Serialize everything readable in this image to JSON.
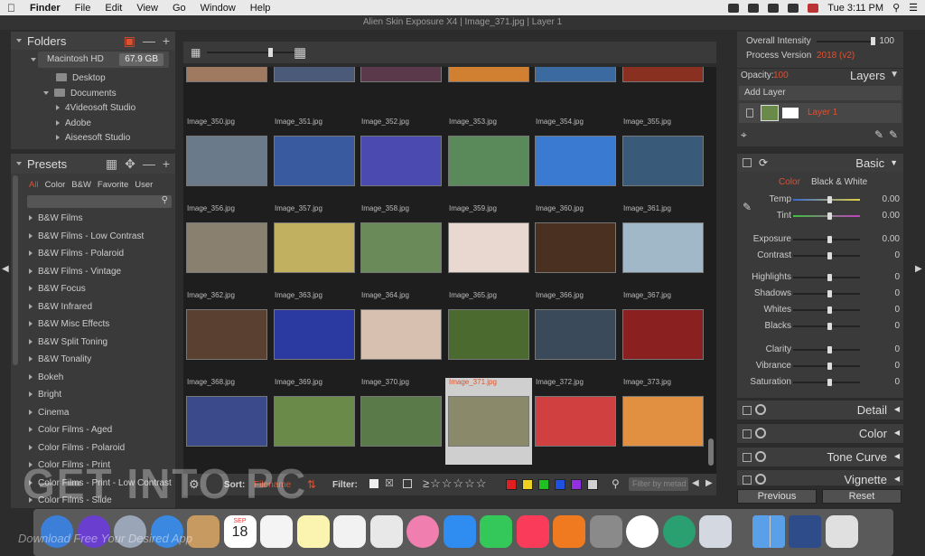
{
  "menubar": {
    "apple": "",
    "app": "Finder",
    "items": [
      "File",
      "Edit",
      "View",
      "Go",
      "Window",
      "Help"
    ],
    "clock": "Tue 3:11 PM"
  },
  "window_title": "Alien Skin Exposure X4 | Image_371.jpg | Layer 1",
  "folders": {
    "title": "Folders",
    "drive": "Macintosh HD",
    "drive_size": "67.9 GB",
    "items": [
      "Desktop",
      "Documents",
      "4Videosoft Studio",
      "Adobe",
      "Aiseesoft Studio"
    ]
  },
  "presets": {
    "title": "Presets",
    "tabs": [
      "All",
      "Color",
      "B&W",
      "Favorite",
      "User"
    ],
    "items": [
      "B&W Films",
      "B&W Films - Low Contrast",
      "B&W Films - Polaroid",
      "B&W Films - Vintage",
      "B&W Focus",
      "B&W Infrared",
      "B&W Misc Effects",
      "B&W Split Toning",
      "B&W Tonality",
      "Bokeh",
      "Bright",
      "Cinema",
      "Color Films - Aged",
      "Color Films - Polaroid",
      "Color Films - Print",
      "Color Films - Print - Low Contrast",
      "Color Films - Slide"
    ]
  },
  "grid": {
    "rows": [
      [
        "Image_350.jpg",
        "Image_351.jpg",
        "Image_352.jpg",
        "Image_353.jpg",
        "Image_354.jpg",
        "Image_355.jpg"
      ],
      [
        "Image_356.jpg",
        "Image_357.jpg",
        "Image_358.jpg",
        "Image_359.jpg",
        "Image_360.jpg",
        "Image_361.jpg"
      ],
      [
        "Image_362.jpg",
        "Image_363.jpg",
        "Image_364.jpg",
        "Image_365.jpg",
        "Image_366.jpg",
        "Image_367.jpg"
      ],
      [
        "Image_368.jpg",
        "Image_369.jpg",
        "Image_370.jpg",
        "Image_371.jpg",
        "Image_372.jpg",
        "Image_373.jpg"
      ]
    ],
    "selected": "Image_371.jpg"
  },
  "bottombar": {
    "sort_label": "Sort:",
    "sort_value": "Filename",
    "filter_label": "Filter:",
    "filter_placeholder": "Filter by metad",
    "swatches": [
      "#e02020",
      "#f0d020",
      "#20c020",
      "#2050e0",
      "#9030e0",
      "#d0d0d0"
    ]
  },
  "intensity": {
    "label": "Overall Intensity",
    "value": "100",
    "process_label": "Process Version",
    "process_value": "2018 (v2)"
  },
  "layers": {
    "opacity_label": "Opacity:",
    "opacity_value": "100",
    "title": "Layers",
    "add": "Add Layer",
    "layer_name": "Layer 1"
  },
  "basic": {
    "title": "Basic",
    "tab_color": "Color",
    "tab_bw": "Black & White",
    "sliders": [
      {
        "label": "Temp",
        "value": "0.00"
      },
      {
        "label": "Tint",
        "value": "0.00"
      },
      {
        "label": "Exposure",
        "value": "0.00"
      },
      {
        "label": "Contrast",
        "value": "0"
      },
      {
        "label": "Highlights",
        "value": "0"
      },
      {
        "label": "Shadows",
        "value": "0"
      },
      {
        "label": "Whites",
        "value": "0"
      },
      {
        "label": "Blacks",
        "value": "0"
      },
      {
        "label": "Clarity",
        "value": "0"
      },
      {
        "label": "Vibrance",
        "value": "0"
      },
      {
        "label": "Saturation",
        "value": "0"
      }
    ]
  },
  "sections": [
    "Detail",
    "Color",
    "Tone Curve",
    "Vignette"
  ],
  "buttons": {
    "previous": "Previous",
    "reset": "Reset"
  },
  "watermark": {
    "main": "GET INTO PC",
    "sub": "Download Free Your Desired App"
  },
  "dock": {
    "colors": [
      "#3c7fd8",
      "#6a3fd0",
      "#9aa6b8",
      "#3a88e0",
      "#c69a60",
      "#a0622e",
      "#f4f4f4",
      "#fbf3b0",
      "#f2f2f2",
      "#e8e8e8",
      "#f07fb0",
      "#2f8cf0",
      "#34c759",
      "#fa3c5a",
      "#f07a20",
      "#8a8a8a",
      "#ffffff",
      "#2aa070",
      "#d4d8e0",
      "#5aa0e8",
      "#2f4c8a",
      "#e0e0e0"
    ],
    "calendar_day": "18",
    "calendar_month": "SEP"
  }
}
